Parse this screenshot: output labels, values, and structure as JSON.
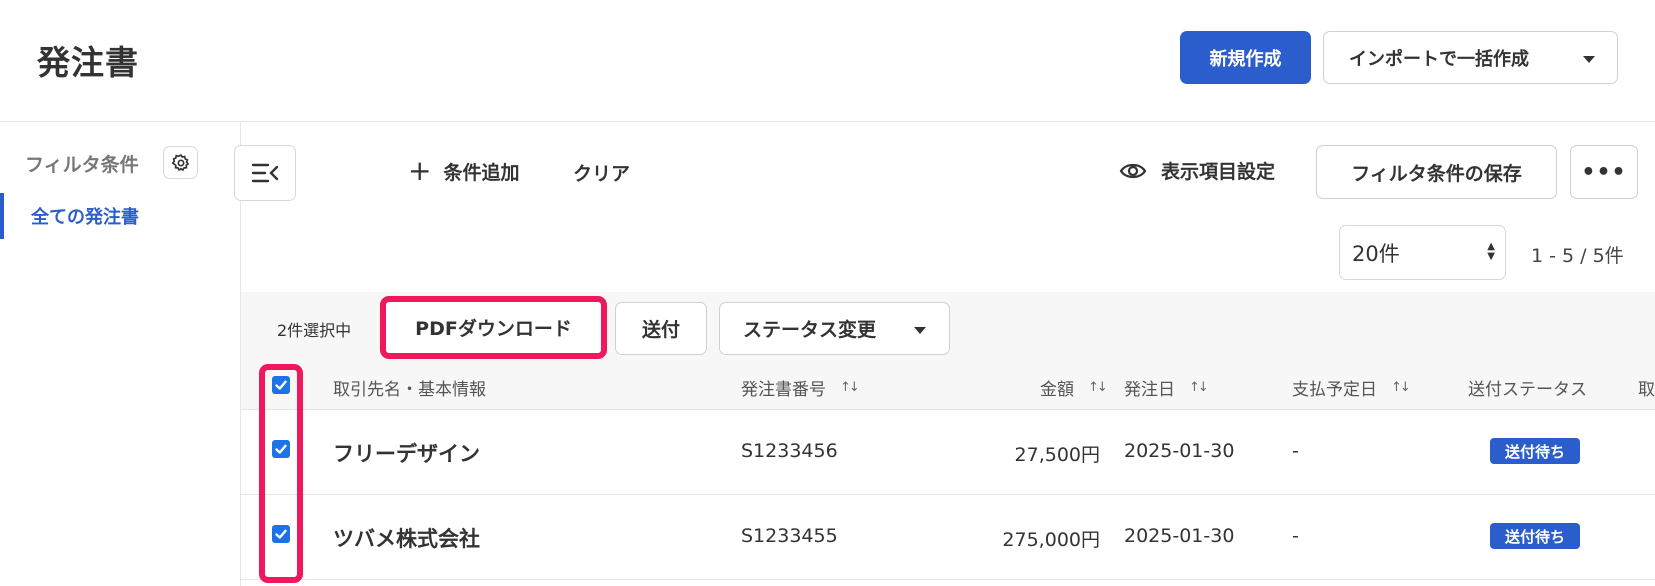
{
  "header": {
    "title": "発注書",
    "new_button": "新規作成",
    "import_button": "インポートで一括作成"
  },
  "sidebar": {
    "heading": "フィルタ条件",
    "items": [
      {
        "label": "全ての発注書",
        "active": true
      }
    ]
  },
  "toolbar": {
    "add_condition": "条件追加",
    "clear": "クリア",
    "display_settings": "表示項目設定",
    "save_filter": "フィルタ条件の保存",
    "more": "•••"
  },
  "pagination": {
    "per_page": "20件",
    "range": "1 - 5 / 5件"
  },
  "selection": {
    "count_label": "2件選択中",
    "pdf_download": "PDFダウンロード",
    "send": "送付",
    "status_change": "ステータス変更"
  },
  "table": {
    "columns": [
      "取引先名・基本情報",
      "発注書番号",
      "金額",
      "発注日",
      "支払予定日",
      "送付ステータス",
      "取"
    ],
    "rows": [
      {
        "partner": "フリーデザイン",
        "number": "S1233456",
        "amount": "27,500円",
        "date": "2025-01-30",
        "payment_date": "-",
        "status": "送付待ち",
        "checked": true
      },
      {
        "partner": "ツバメ株式会社",
        "number": "S1233455",
        "amount": "275,000円",
        "date": "2025-01-30",
        "payment_date": "-",
        "status": "送付待ち",
        "checked": true
      }
    ]
  },
  "colors": {
    "primary": "#2b5dcc",
    "highlight": "#f0185c",
    "checkbox": "#1a73e8"
  }
}
